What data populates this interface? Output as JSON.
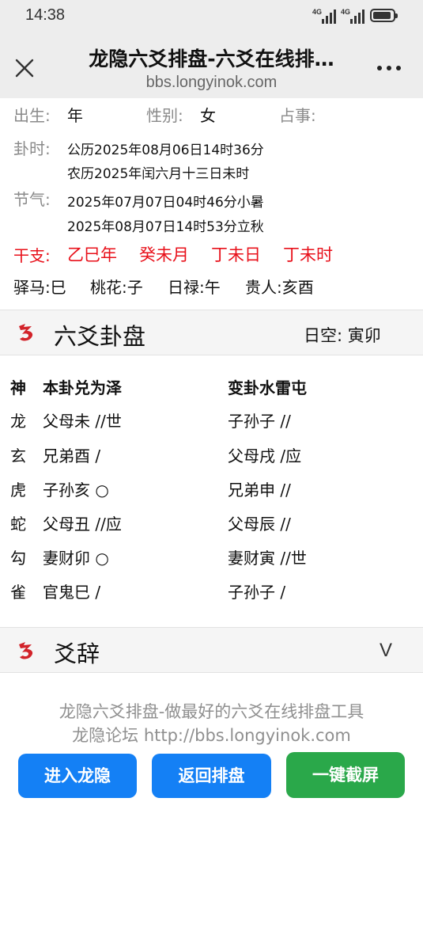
{
  "status": {
    "time": "14:38",
    "network1": "4G",
    "network2": "4G"
  },
  "browser": {
    "title": "龙隐六爻排盘-六爻在线排…",
    "url": "bbs.longyinok.com"
  },
  "info": {
    "birth_label": "出生:",
    "birth_value": "年",
    "gender_label": "性别:",
    "gender_value": "女",
    "matter_label": "占事:",
    "time_label": "卦时:",
    "time_solar": "公历2025年08月06日14时36分",
    "time_lunar": "农历2025年闰六月十三日未时",
    "jieqi_label": "节气:",
    "jieqi_1": "2025年07月07日04时46分小暑",
    "jieqi_2": "2025年08月07日14时53分立秋",
    "ganzhi_label": "干支:",
    "ganzhi": [
      "乙巳年",
      "癸未月",
      "丁未日",
      "丁未时"
    ],
    "shensha": [
      "驿马:巳",
      "桃花:子",
      "日禄:午",
      "贵人:亥酉"
    ]
  },
  "hexagram_section": {
    "title": "六爻卦盘",
    "kong": "日空: 寅卯"
  },
  "hexagram": {
    "header": {
      "god": "神",
      "main": "本卦兑为泽",
      "changed": "变卦水雷屯"
    },
    "rows": [
      {
        "god": "龙",
        "main": "父母未 //世",
        "changed": "子孙子 //"
      },
      {
        "god": "玄",
        "main": "兄弟酉 /",
        "changed": "父母戌 /应"
      },
      {
        "god": "虎",
        "main": "子孙亥 ○",
        "changed": "兄弟申 //"
      },
      {
        "god": "蛇",
        "main": "父母丑 //应",
        "changed": "父母辰 //"
      },
      {
        "god": "勾",
        "main": "妻财卯 ○",
        "changed": "妻财寅 //世"
      },
      {
        "god": "雀",
        "main": "官鬼巳 /",
        "changed": "子孙子 /"
      }
    ]
  },
  "yaoci_section": {
    "title": "爻辞",
    "toggle": "V"
  },
  "footer": {
    "line1": "龙隐六爻排盘-做最好的六爻在线排盘工具",
    "line2": "龙隐论坛 http://bbs.longyinok.com",
    "btn_enter": "进入龙隐",
    "btn_back": "返回排盘",
    "btn_screenshot": "一键截屏"
  },
  "colors": {
    "accent_red": "#e8101a",
    "button_blue": "#1480f5",
    "button_green": "#2aa84a",
    "dragon_red": "#d2232a"
  }
}
